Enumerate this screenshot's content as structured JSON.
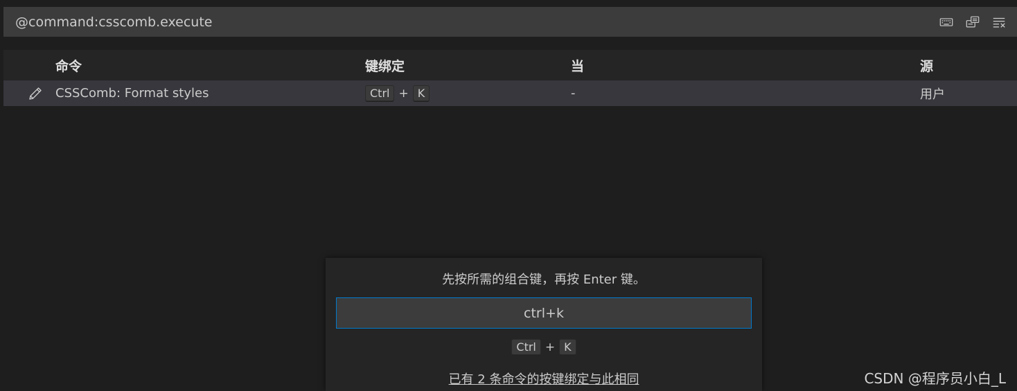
{
  "search": {
    "value": "@command:csscomb.execute"
  },
  "toolbar": {
    "icons": [
      "keyboard-icon",
      "record-keys-icon",
      "clear-filter-icon"
    ]
  },
  "table": {
    "headers": {
      "command": "命令",
      "keybinding": "键绑定",
      "when": "当",
      "source": "源"
    },
    "rows": [
      {
        "command": "CSSComb: Format styles",
        "keys": [
          "Ctrl",
          "K"
        ],
        "when": "-",
        "source": "用户"
      }
    ]
  },
  "define_keybinding": {
    "message": "先按所需的组合键，再按 Enter 键。",
    "input_value": "ctrl+k",
    "preview_keys": [
      "Ctrl",
      "K"
    ],
    "conflict_text": "已有 2 条命令的按键绑定与此相同"
  },
  "plus_sign": "+",
  "watermark": "CSDN @程序员小白_L"
}
